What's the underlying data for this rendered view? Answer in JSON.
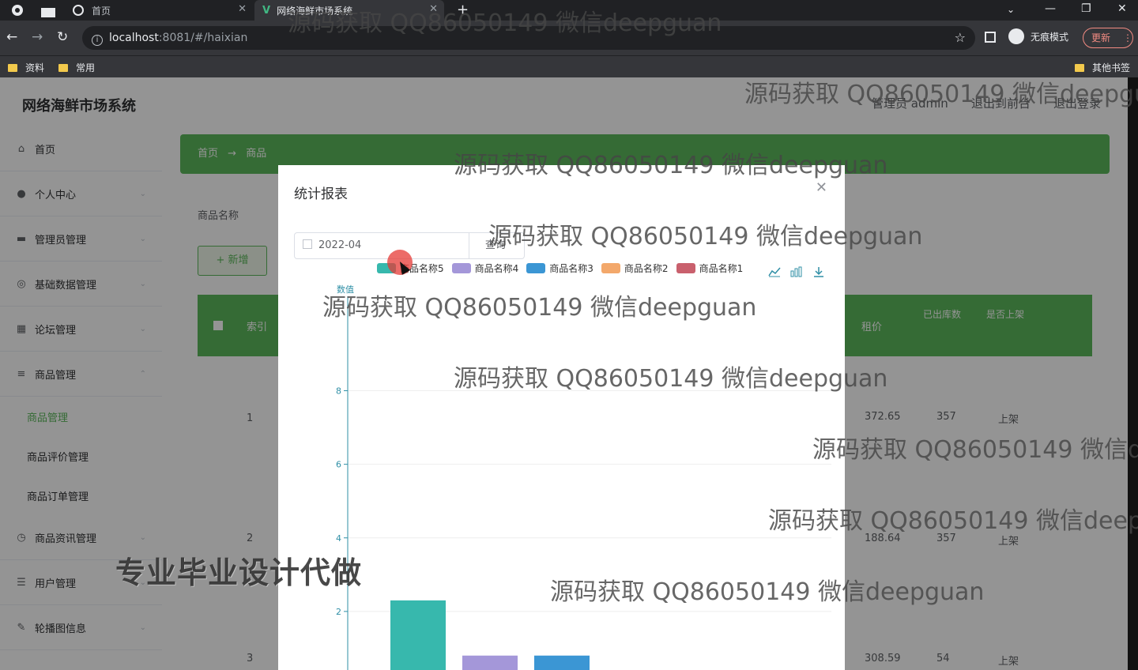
{
  "browser": {
    "tabs": [
      {
        "title": "首页"
      },
      {
        "title": "网络海鲜市场系统"
      }
    ],
    "url_host": "localhost",
    "url_rest": ":8081/#/haixian",
    "incognito_label": "无痕模式",
    "update_label": "更新",
    "bookmarks": [
      "资料",
      "常用"
    ],
    "other_bookmarks": "其他书签"
  },
  "app": {
    "title": "网络海鲜市场系统",
    "user_links": [
      "管理员 admin",
      "退出到前台",
      "退出登录"
    ],
    "sidebar": {
      "items": [
        {
          "label": "首页"
        },
        {
          "label": "个人中心"
        },
        {
          "label": "管理员管理"
        },
        {
          "label": "基础数据管理"
        },
        {
          "label": "论坛管理"
        },
        {
          "label": "商品管理"
        }
      ],
      "sub_items": [
        "商品管理",
        "商品评价管理",
        "商品订单管理"
      ],
      "items_after": [
        {
          "label": "商品资讯管理"
        },
        {
          "label": "用户管理"
        },
        {
          "label": "轮播图信息"
        }
      ]
    },
    "breadcrumb": [
      "首页",
      "→",
      "商品"
    ],
    "search_label": "商品名称",
    "add_button": "+ 新增",
    "table": {
      "headers": [
        "索引",
        "租价",
        "已出库数",
        "是否上架"
      ],
      "rows": [
        {
          "index": "1",
          "price": "372.65",
          "stock": "357",
          "status": "上架"
        },
        {
          "index": "2",
          "price": "188.64",
          "stock": "357",
          "status": "上架"
        },
        {
          "index": "3",
          "price": "308.59",
          "stock": "54",
          "status": "上架"
        }
      ]
    }
  },
  "dialog": {
    "title": "统计报表",
    "date_value": "2022-04",
    "query_button": "查询",
    "toolbox_icons": [
      "line-chart-icon",
      "bar-chart-icon",
      "download-icon"
    ]
  },
  "chart_data": {
    "type": "bar",
    "ylabel": "数值",
    "yticks": [
      2,
      4,
      6,
      8
    ],
    "ylim": [
      0,
      10
    ],
    "series": [
      {
        "name": "商品名称5",
        "color": "#37b8ad",
        "value": 2.3
      },
      {
        "name": "商品名称4",
        "color": "#a497d9",
        "value": 0.8
      },
      {
        "name": "商品名称3",
        "color": "#3b96d4",
        "value": 0.8
      },
      {
        "name": "商品名称2",
        "color": "#f3a86b",
        "value": 0.2
      },
      {
        "name": "商品名称1",
        "color": "#c9606d",
        "value": 0
      }
    ]
  },
  "watermarks": {
    "qq": "源码获取 QQ86050149 微信deepguan",
    "big": "专业毕业设计代做"
  }
}
